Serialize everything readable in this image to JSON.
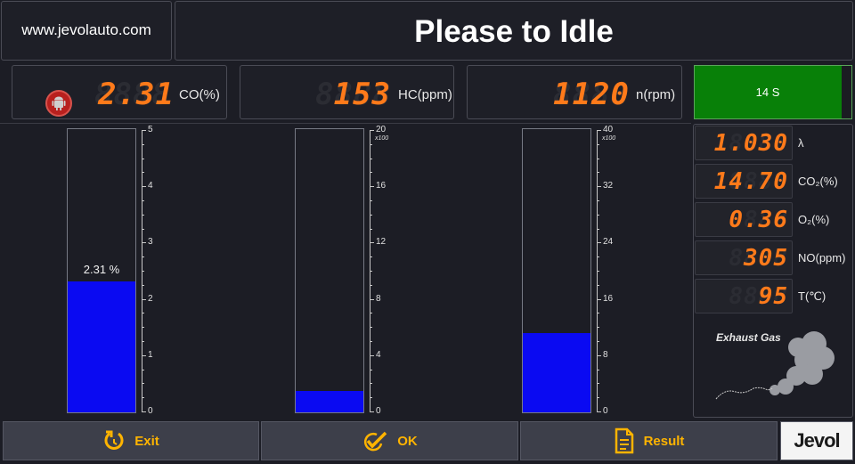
{
  "header": {
    "website": "www.jevolauto.com",
    "instruction": "Please to Idle"
  },
  "top_readouts": [
    {
      "value": "2.31",
      "unit": "CO(%)"
    },
    {
      "value": "153",
      "unit": "HC(ppm)"
    },
    {
      "value": "1120",
      "unit": "n(rpm)"
    }
  ],
  "timer": {
    "label": "14 S",
    "color": "#088008"
  },
  "gauges": [
    {
      "name": "CO",
      "fill_percent": 46.2,
      "value_label": "2.31 %",
      "ticks": [
        "5",
        "4",
        "3",
        "2",
        "1",
        "0"
      ],
      "multiplier": ""
    },
    {
      "name": "HC",
      "fill_percent": 7.65,
      "value_label": "",
      "ticks": [
        "20",
        "16",
        "12",
        "8",
        "4",
        "0"
      ],
      "multiplier": "x100"
    },
    {
      "name": "RPM",
      "fill_percent": 28,
      "value_label": "",
      "ticks": [
        "40",
        "32",
        "24",
        "16",
        "8",
        "0"
      ],
      "multiplier": "x100"
    }
  ],
  "side_readouts": [
    {
      "value": "1.030",
      "unit": "λ"
    },
    {
      "value": "14.70",
      "unit": "CO₂(%)"
    },
    {
      "value": "0.36",
      "unit": "O₂(%)"
    },
    {
      "value": "305",
      "unit": "NO(ppm)"
    },
    {
      "value": "95",
      "unit": "T(℃)"
    }
  ],
  "exhaust": {
    "label": "Exhaust Gas"
  },
  "buttons": {
    "exit": "Exit",
    "ok": "OK",
    "result": "Result"
  },
  "brand": {
    "logo": "Jevol"
  },
  "colors": {
    "accent": "#ffb400",
    "digits": "#ff7a1a",
    "bar": "#0a0af2",
    "timer": "#088008"
  }
}
